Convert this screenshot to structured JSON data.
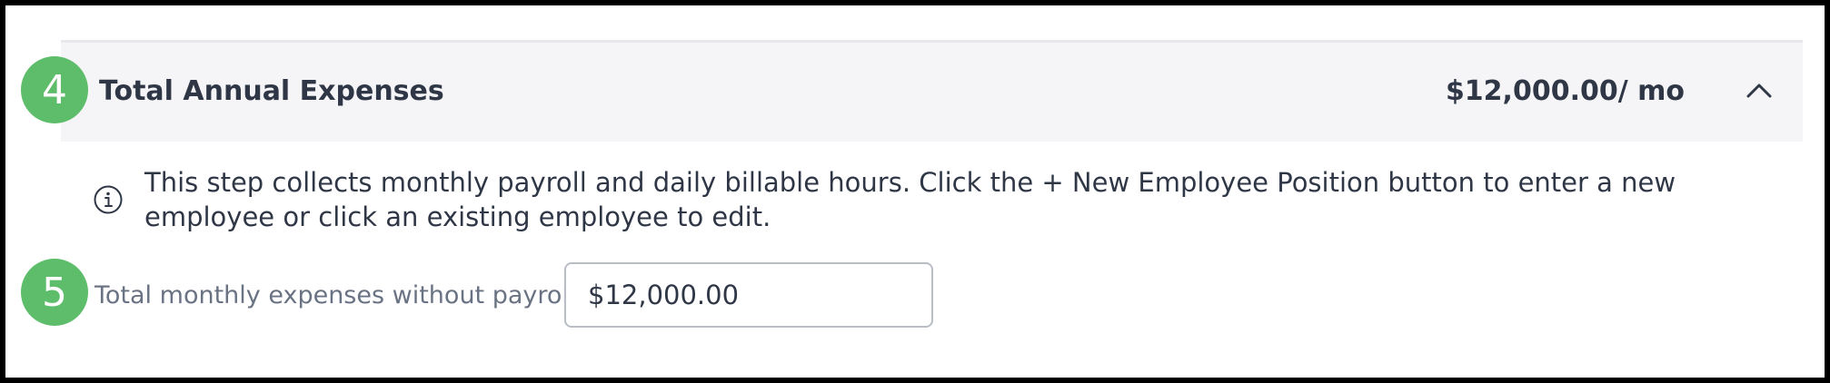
{
  "steps": {
    "header_step": "4",
    "field_step": "5"
  },
  "section": {
    "title": "Total Annual Expenses",
    "amount": "$12,000.00/ mo",
    "collapse_icon": "chevron-up-icon"
  },
  "info": {
    "icon": "info-circle-icon",
    "text": "This step collects monthly payroll and daily billable hours. Click the + New Employee Position button to enter a new employee or click an existing employee to edit."
  },
  "expenses_field": {
    "label": "Total monthly expenses without payroll",
    "value": "$12,000.00"
  },
  "colors": {
    "badge": "#5ebd6a",
    "header_background": "#f5f5f7",
    "text": "#2f3747",
    "label_text": "#6a7383",
    "frame": "#000000"
  }
}
